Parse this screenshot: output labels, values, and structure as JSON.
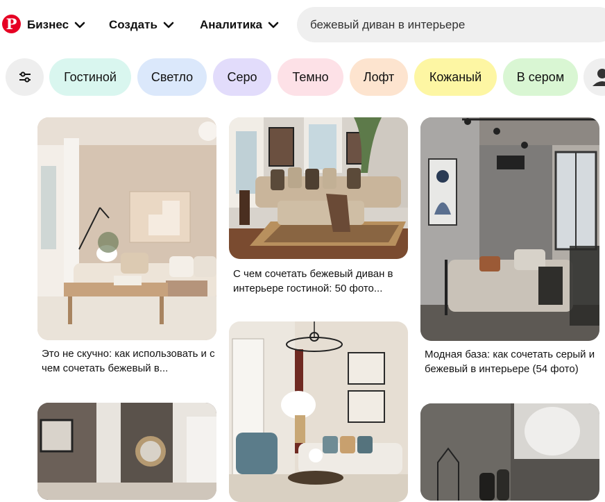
{
  "brand": {
    "logo_letter": "P",
    "color": "#e60023"
  },
  "nav": {
    "business": "Бизнес",
    "create": "Создать",
    "analytics": "Аналитика"
  },
  "search": {
    "value": "бежевый диван в интерьере"
  },
  "chips": [
    {
      "label": "Гостиной",
      "color": "#d9f6ef"
    },
    {
      "label": "Светло",
      "color": "#dbe8fb"
    },
    {
      "label": "Серо",
      "color": "#e2dcfb"
    },
    {
      "label": "Темно",
      "color": "#fde1e7"
    },
    {
      "label": "Лофт",
      "color": "#fde4cf"
    },
    {
      "label": "Кожаный",
      "color": "#fdf6a3"
    },
    {
      "label": "В сером",
      "color": "#d9f6d3"
    }
  ],
  "pins": [
    {
      "caption": "Это не скучно: как использовать и с чем сочетать бежевый в..."
    },
    {
      "caption": "С чем сочетать бежевый диван в интерьере гостиной: 50 фото..."
    },
    {
      "caption": "Модная база: как сочетать серый и бежевый в интерьере (54 фото)"
    }
  ]
}
